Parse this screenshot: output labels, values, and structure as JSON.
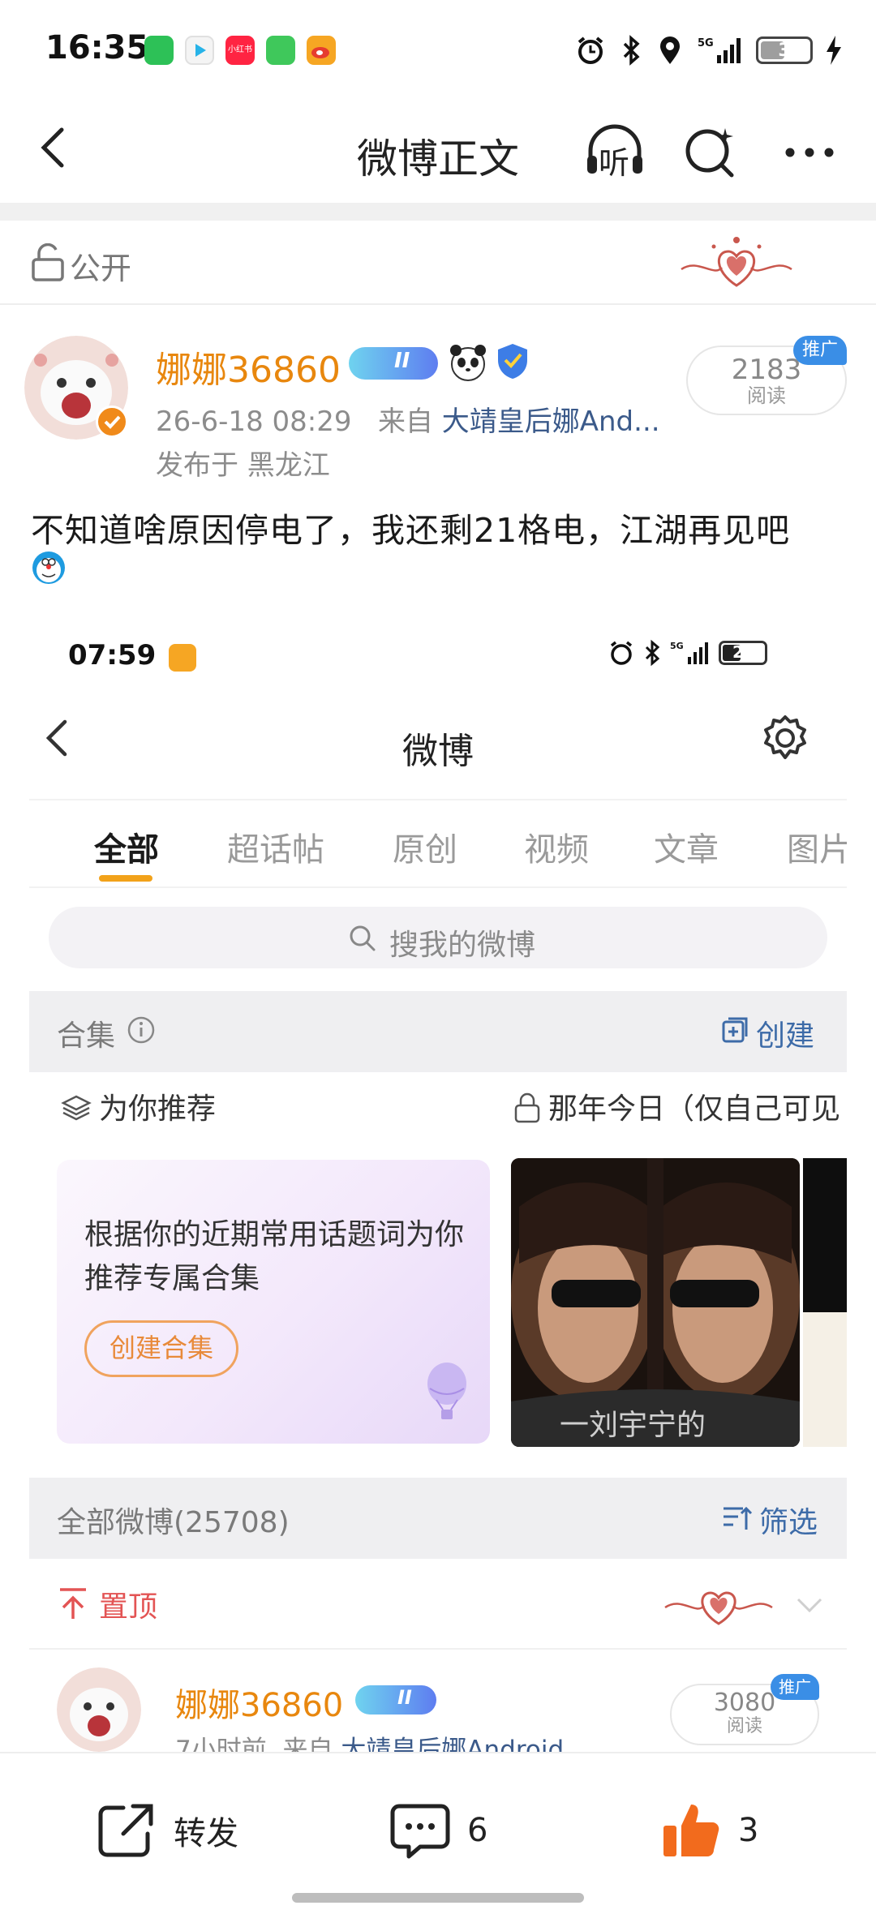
{
  "status_bar": {
    "time": "16:35",
    "battery": "3",
    "app_icons": [
      "wechat-icon",
      "video-app-icon",
      "xiaohongshu-icon",
      "messages-icon",
      "weibo-icon"
    ],
    "xiaohongshu_label": "小红书"
  },
  "nav": {
    "title": "微博正文",
    "listen_label": "听"
  },
  "visibility": {
    "label": "公开"
  },
  "post": {
    "user_name": "娜娜36860",
    "level_badge": "II",
    "timestamp": "26-6-18 08:29",
    "source_prefix": "来自",
    "source": "大靖皇后娜And...",
    "location": "发布于 黑龙江",
    "reads": "2183",
    "reads_label": "阅读",
    "promo_badge": "推广",
    "text": "不知道啥原因停电了，我还剩21格电，江湖再见吧"
  },
  "embedded": {
    "status_time": "07:59",
    "battery": "21",
    "title": "微博",
    "tabs": [
      "全部",
      "超话帖",
      "原创",
      "视频",
      "文章",
      "图片"
    ],
    "active_tab": "全部",
    "search_placeholder": "搜我的微博",
    "collection_label": "合集",
    "create_label": "创建",
    "recommend_label": "为你推荐",
    "past_label": "那年今日（仅自己可见",
    "card_text": "根据你的近期常用话题词为你推荐专属合集",
    "card_button": "创建合集",
    "photo_caption": "一刘宇宁的",
    "all_posts_label": "全部微博(25708)",
    "filter_label": "筛选",
    "pinned_label": "置顶",
    "user_name": "娜娜36860",
    "level_badge": "II",
    "meta_time": "7小时前",
    "meta_prefix": "来自",
    "meta_source": "大靖皇后娜Android",
    "reads": "3080",
    "reads_label": "阅读",
    "promo_badge": "推广"
  },
  "bottom_bar": {
    "repost_label": "转发",
    "comment_count": "6",
    "like_count": "3"
  },
  "colors": {
    "username_orange": "#e8870e",
    "link_blue": "#3b5a8a",
    "like_orange": "#f26b1d",
    "promo_blue": "#3a8ee6",
    "accent_yellow": "#f2a21a"
  }
}
